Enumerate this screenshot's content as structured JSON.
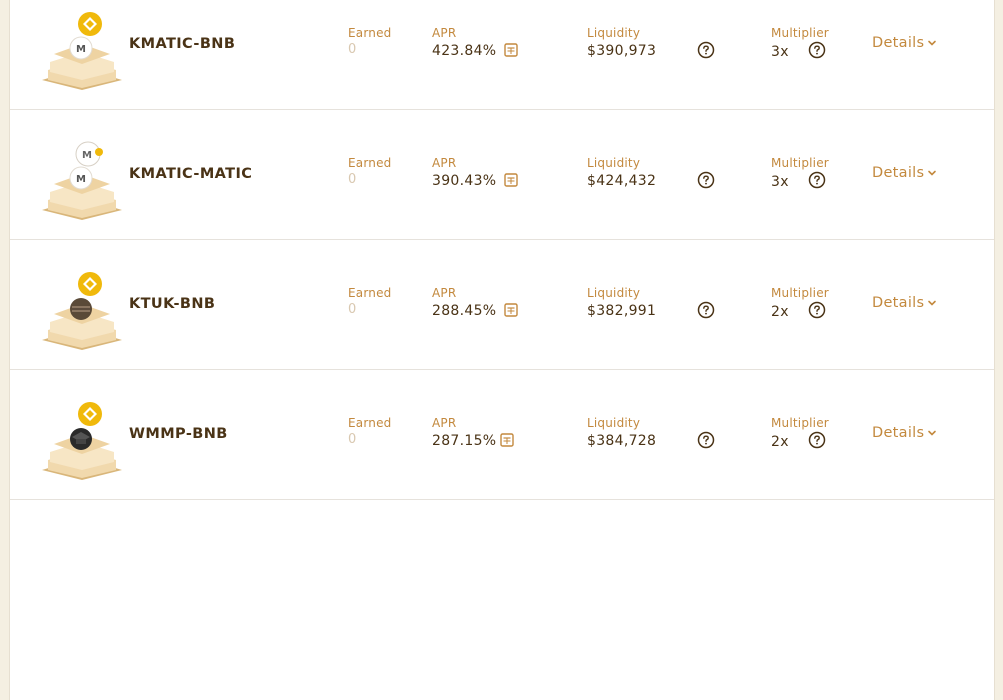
{
  "labels": {
    "earned": "Earned",
    "apr": "APR",
    "liquidity": "Liquidity",
    "multiplier": "Multiplier",
    "details": "Details"
  },
  "colors": {
    "accent": "#c3893e",
    "text": "#4a3316",
    "muted": "#d9c8b0",
    "background": "#f4efe2"
  },
  "farms": [
    {
      "pair": "KMATIC-BNB",
      "earned": "0",
      "apr": "423.84%",
      "liquidity": "$390,973",
      "multiplier": "3x",
      "token_top": "bnb-icon",
      "token_bottom": "kmatic-icon"
    },
    {
      "pair": "KMATIC-MATIC",
      "earned": "0",
      "apr": "390.43%",
      "liquidity": "$424,432",
      "multiplier": "3x",
      "token_top": "matic-icon",
      "token_bottom": "kmatic-icon"
    },
    {
      "pair": "KTUK-BNB",
      "earned": "0",
      "apr": "288.45%",
      "liquidity": "$382,991",
      "multiplier": "2x",
      "token_top": "bnb-icon",
      "token_bottom": "ktuk-icon"
    },
    {
      "pair": "WMMP-BNB",
      "earned": "0",
      "apr": "287.15%",
      "liquidity": "$384,728",
      "multiplier": "2x",
      "token_top": "bnb-icon",
      "token_bottom": "wmmp-icon"
    }
  ]
}
